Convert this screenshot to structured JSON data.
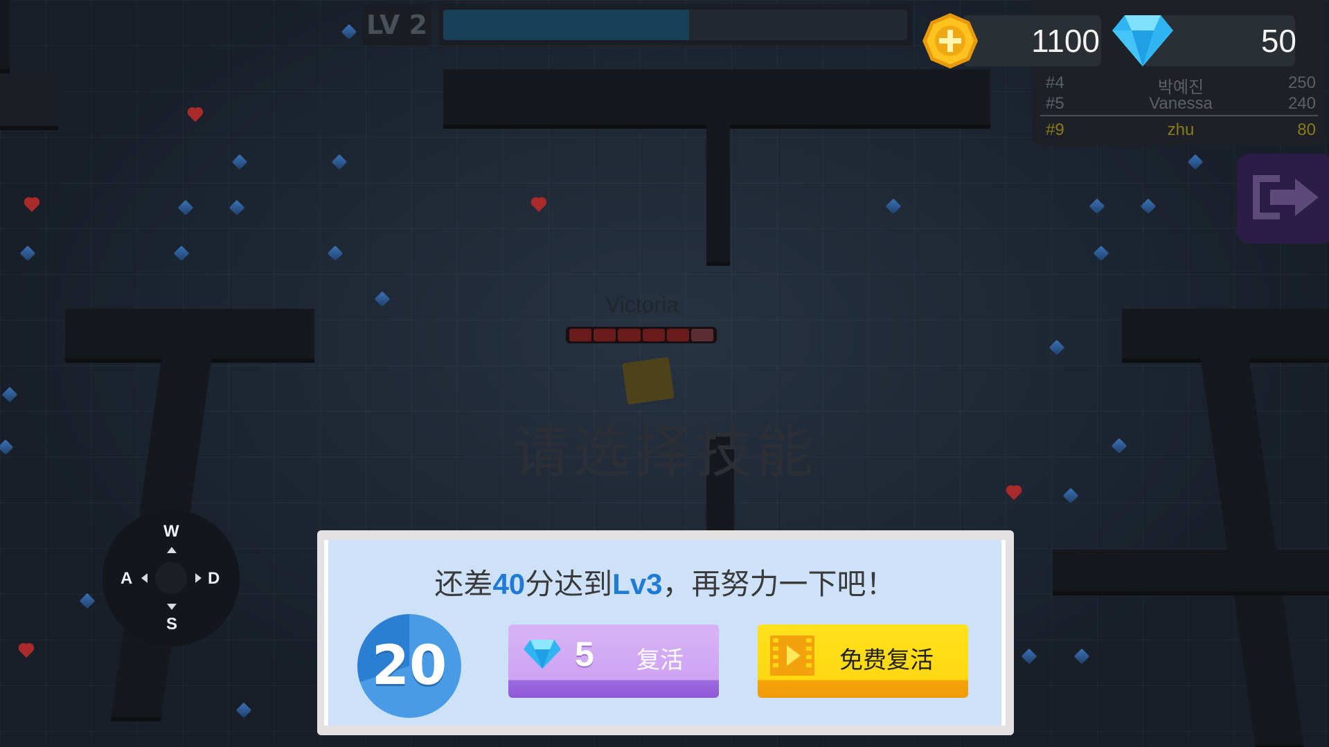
{
  "hud": {
    "level_label": "LV 2",
    "xp_progress": 0.53,
    "coins": "1100",
    "gems": "50"
  },
  "leaderboard": {
    "rows": [
      {
        "rank": "#4",
        "name": "박예진",
        "score": "250"
      },
      {
        "rank": "#5",
        "name": "Vanessa",
        "score": "240"
      }
    ],
    "me": {
      "rank": "#9",
      "name": "zhu",
      "score": "80"
    }
  },
  "player": {
    "name": "Victoria",
    "hp_segments": 6
  },
  "skill_hint": "请选择技能",
  "joystick": {
    "up": "W",
    "left": "A",
    "right": "D",
    "down": "S"
  },
  "revive_dialog": {
    "message_prefix": "还差",
    "points": "40",
    "message_mid": "分达到",
    "target_level": "Lv3",
    "message_suffix": "，再努力一下吧！",
    "countdown": "20",
    "gem_cost": "5",
    "gem_revive_label": "复活",
    "free_revive_label": "免费复活"
  },
  "colors": {
    "accent_blue": "#1f7bd6",
    "gem_button": "#cda3f2",
    "free_button": "#ffd812"
  },
  "icons": [
    "coin-icon",
    "gem-icon",
    "exit-icon",
    "video-icon"
  ]
}
